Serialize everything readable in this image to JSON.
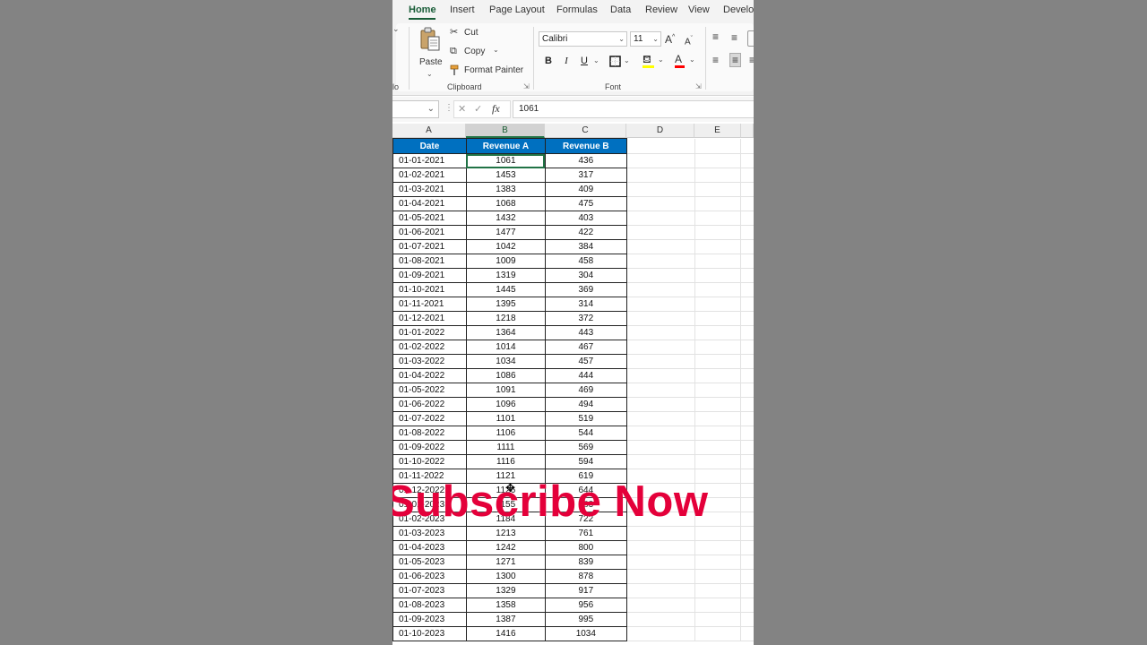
{
  "ribbon_tabs": [
    "Home",
    "Insert",
    "Page Layout",
    "Formulas",
    "Data",
    "Review",
    "View",
    "Develop"
  ],
  "active_tab": "Home",
  "clipboard": {
    "group_label": "Clipboard",
    "paste": "Paste",
    "cut": "Cut",
    "copy": "Copy",
    "format_painter": "Format Painter",
    "left_fragment": "lo"
  },
  "font": {
    "group_label": "Font",
    "family": "Calibri",
    "size": "11",
    "bold": "B",
    "italic": "I",
    "underline": "U"
  },
  "formula_bar": {
    "fx": "fx",
    "value": "1061"
  },
  "columns": [
    "A",
    "B",
    "C",
    "D",
    "E"
  ],
  "selected_column": "B",
  "table": {
    "headers": [
      "Date",
      "Revenue A",
      "Revenue B"
    ],
    "rows": [
      [
        "01-01-2021",
        "1061",
        "436"
      ],
      [
        "01-02-2021",
        "1453",
        "317"
      ],
      [
        "01-03-2021",
        "1383",
        "409"
      ],
      [
        "01-04-2021",
        "1068",
        "475"
      ],
      [
        "01-05-2021",
        "1432",
        "403"
      ],
      [
        "01-06-2021",
        "1477",
        "422"
      ],
      [
        "01-07-2021",
        "1042",
        "384"
      ],
      [
        "01-08-2021",
        "1009",
        "458"
      ],
      [
        "01-09-2021",
        "1319",
        "304"
      ],
      [
        "01-10-2021",
        "1445",
        "369"
      ],
      [
        "01-11-2021",
        "1395",
        "314"
      ],
      [
        "01-12-2021",
        "1218",
        "372"
      ],
      [
        "01-01-2022",
        "1364",
        "443"
      ],
      [
        "01-02-2022",
        "1014",
        "467"
      ],
      [
        "01-03-2022",
        "1034",
        "457"
      ],
      [
        "01-04-2022",
        "1086",
        "444"
      ],
      [
        "01-05-2022",
        "1091",
        "469"
      ],
      [
        "01-06-2022",
        "1096",
        "494"
      ],
      [
        "01-07-2022",
        "1101",
        "519"
      ],
      [
        "01-08-2022",
        "1106",
        "544"
      ],
      [
        "01-09-2022",
        "1111",
        "569"
      ],
      [
        "01-10-2022",
        "1116",
        "594"
      ],
      [
        "01-11-2022",
        "1121",
        "619"
      ],
      [
        "01-12-2022",
        "1126",
        "644"
      ],
      [
        "01-01-2023",
        "1155",
        "683"
      ],
      [
        "01-02-2023",
        "1184",
        "722"
      ],
      [
        "01-03-2023",
        "1213",
        "761"
      ],
      [
        "01-04-2023",
        "1242",
        "800"
      ],
      [
        "01-05-2023",
        "1271",
        "839"
      ],
      [
        "01-06-2023",
        "1300",
        "878"
      ],
      [
        "01-07-2023",
        "1329",
        "917"
      ],
      [
        "01-08-2023",
        "1358",
        "956"
      ],
      [
        "01-09-2023",
        "1387",
        "995"
      ],
      [
        "01-10-2023",
        "1416",
        "1034"
      ]
    ]
  },
  "overlay_text": "Subscribe  Now",
  "colors": {
    "header_fill": "#0070c0",
    "selection": "#217346",
    "overlay": "#e4003a"
  }
}
